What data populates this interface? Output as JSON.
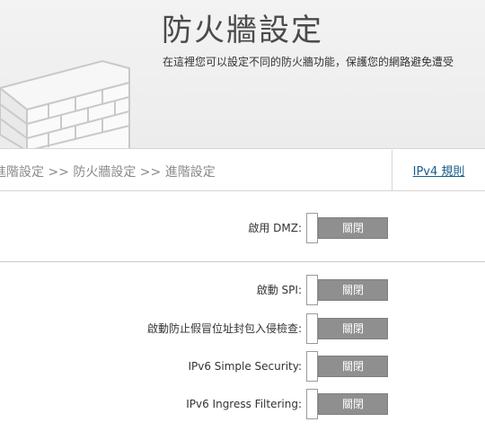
{
  "header": {
    "title": "防火牆設定",
    "description": "在這裡您可以設定不同的防火牆功能，保護您的網路避免遭受"
  },
  "nav": {
    "breadcrumb": "進階設定 >> 防火牆設定 >> 進階設定",
    "rules_link": "IPv4 規則"
  },
  "dmz": {
    "label": "啟用 DMZ:",
    "state": "關閉"
  },
  "settings": [
    {
      "label": "啟動 SPI:",
      "state": "關閉"
    },
    {
      "label": "啟動防止假冒位址封包入侵檢查:",
      "state": "關閉"
    },
    {
      "label": "IPv6 Simple Security:",
      "state": "關閉"
    },
    {
      "label": "IPv6 Ingress Filtering:",
      "state": "關閉"
    }
  ],
  "colors": {
    "toggle_off": "#8f8f8f",
    "link": "#1a5c8c"
  }
}
